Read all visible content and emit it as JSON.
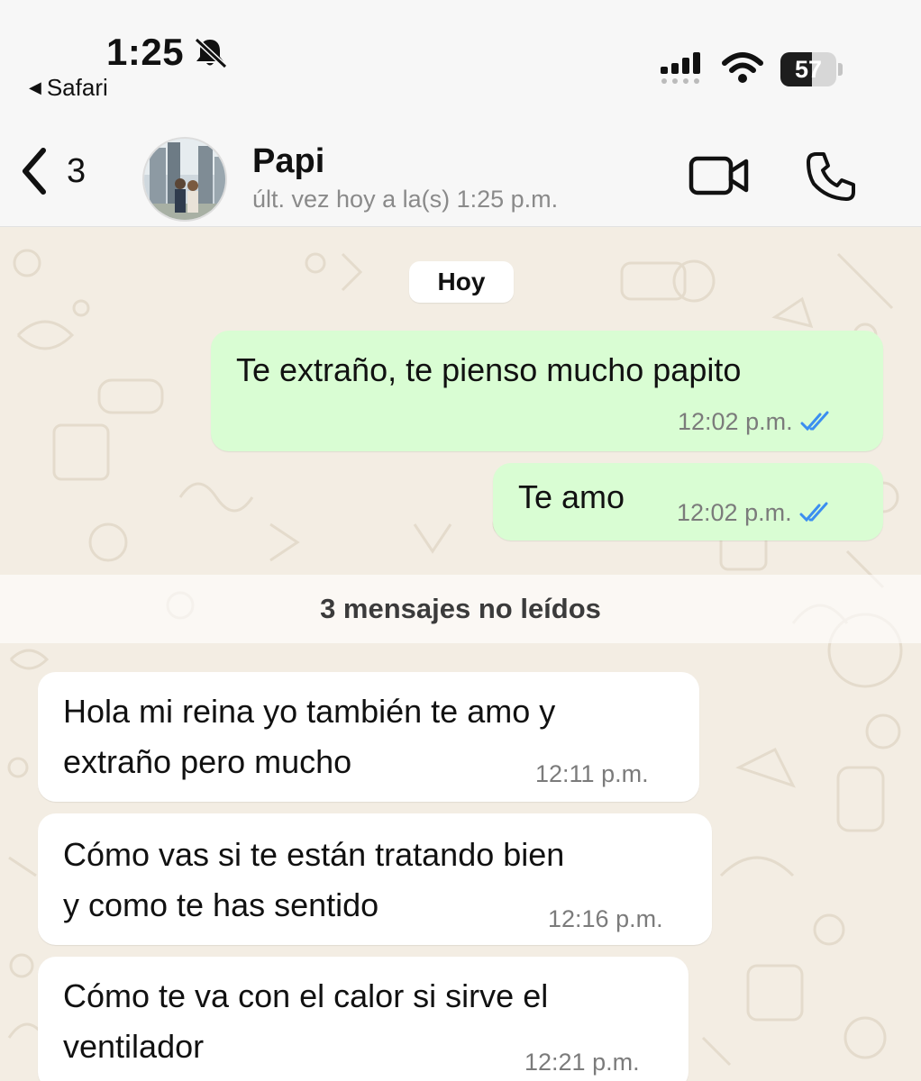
{
  "status_bar": {
    "time": "1:25",
    "back_app": "Safari",
    "battery": "57",
    "battery_level": 0.57
  },
  "header": {
    "back_count": "3",
    "contact_name": "Papi",
    "last_seen": "últ. vez hoy a la(s) 1:25 p.m."
  },
  "chat": {
    "date_chip": "Hoy",
    "outgoing": [
      {
        "text": "Te extraño, te pienso mucho papito",
        "time": "12:02 p.m."
      },
      {
        "text": "Te amo",
        "time": "12:02 p.m."
      }
    ],
    "unread_banner": "3 mensajes no leídos",
    "incoming": [
      {
        "text": "Hola mi reina yo también te amo y\nextraño pero mucho",
        "time": "12:11 p.m."
      },
      {
        "text": "Cómo vas si te están tratando bien\ny como te has sentido",
        "time": "12:16 p.m."
      },
      {
        "text": "Cómo te va con el calor si sirve el\nventilador",
        "time": "12:21 p.m."
      }
    ]
  },
  "colors": {
    "outgoing_bubble": "#d9fdd3",
    "incoming_bubble": "#ffffff",
    "read_ticks": "#3b8ef0"
  }
}
